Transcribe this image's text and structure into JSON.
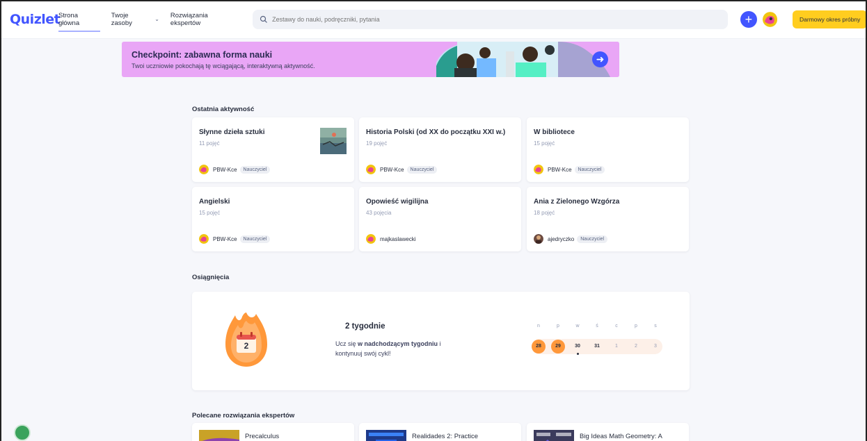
{
  "header": {
    "logo": "Quizlet",
    "nav": [
      {
        "label": "Strona główna"
      },
      {
        "label": "Twoje zasoby"
      },
      {
        "label": "Rozwiązania ekspertów"
      }
    ],
    "search_placeholder": "Zestawy do nauki, podręczniki, pytania",
    "trial_button": "Darmowy okres próbny"
  },
  "banner": {
    "title": "Checkpoint: zabawna forma nauki",
    "subtitle": "Twoi uczniowie pokochają tę wciągającą, interaktywną aktywność."
  },
  "recent": {
    "title": "Ostatnia aktywność",
    "cards": [
      {
        "title": "Słynne dzieła sztuki",
        "terms": "11 pojęć",
        "user": "PBW-Kce",
        "badge": "Nauczyciel"
      },
      {
        "title": "Historia Polski (od XX do początku XXI w.)",
        "terms": "19 pojęć",
        "user": "PBW-Kce",
        "badge": "Nauczyciel"
      },
      {
        "title": "W bibliotece",
        "terms": "15 pojęć",
        "user": "PBW-Kce",
        "badge": "Nauczyciel"
      },
      {
        "title": "Angielski",
        "terms": "15 pojęć",
        "user": "PBW-Kce",
        "badge": "Nauczyciel"
      },
      {
        "title": "Opowieść wigilijna",
        "terms": "43 pojęcia",
        "user": "majkaslawecki",
        "badge": ""
      },
      {
        "title": "Ania z Zielonego Wzgórza",
        "terms": "18 pojęć",
        "user": "ajedryczko",
        "badge": "Nauczyciel"
      }
    ]
  },
  "achievements": {
    "title": "Osiągnięcia",
    "streak_number": "2",
    "streak_title": "2 tygodnie",
    "line1_pre": "Ucz się ",
    "line1_bold": "w nadchodzącym tygodniu",
    "line1_post": " i",
    "line2": "kontynuuj swój cykl!",
    "week_days": [
      "n",
      "p",
      "w",
      "ś",
      "c",
      "p",
      "s"
    ],
    "week_dates": [
      "28",
      "29",
      "30",
      "31",
      "1",
      "2",
      "3"
    ]
  },
  "experts": {
    "title": "Polecane rozwiązania ekspertów",
    "items": [
      {
        "title": "Precalculus"
      },
      {
        "title": "Realidades 2: Practice"
      },
      {
        "title": "Big Ideas Math Geometry: A"
      }
    ]
  },
  "colors": {
    "brand": "#4255ff",
    "trial": "#ffcd1f",
    "banner": "#e9a6f6",
    "streak": "#ff983a"
  }
}
